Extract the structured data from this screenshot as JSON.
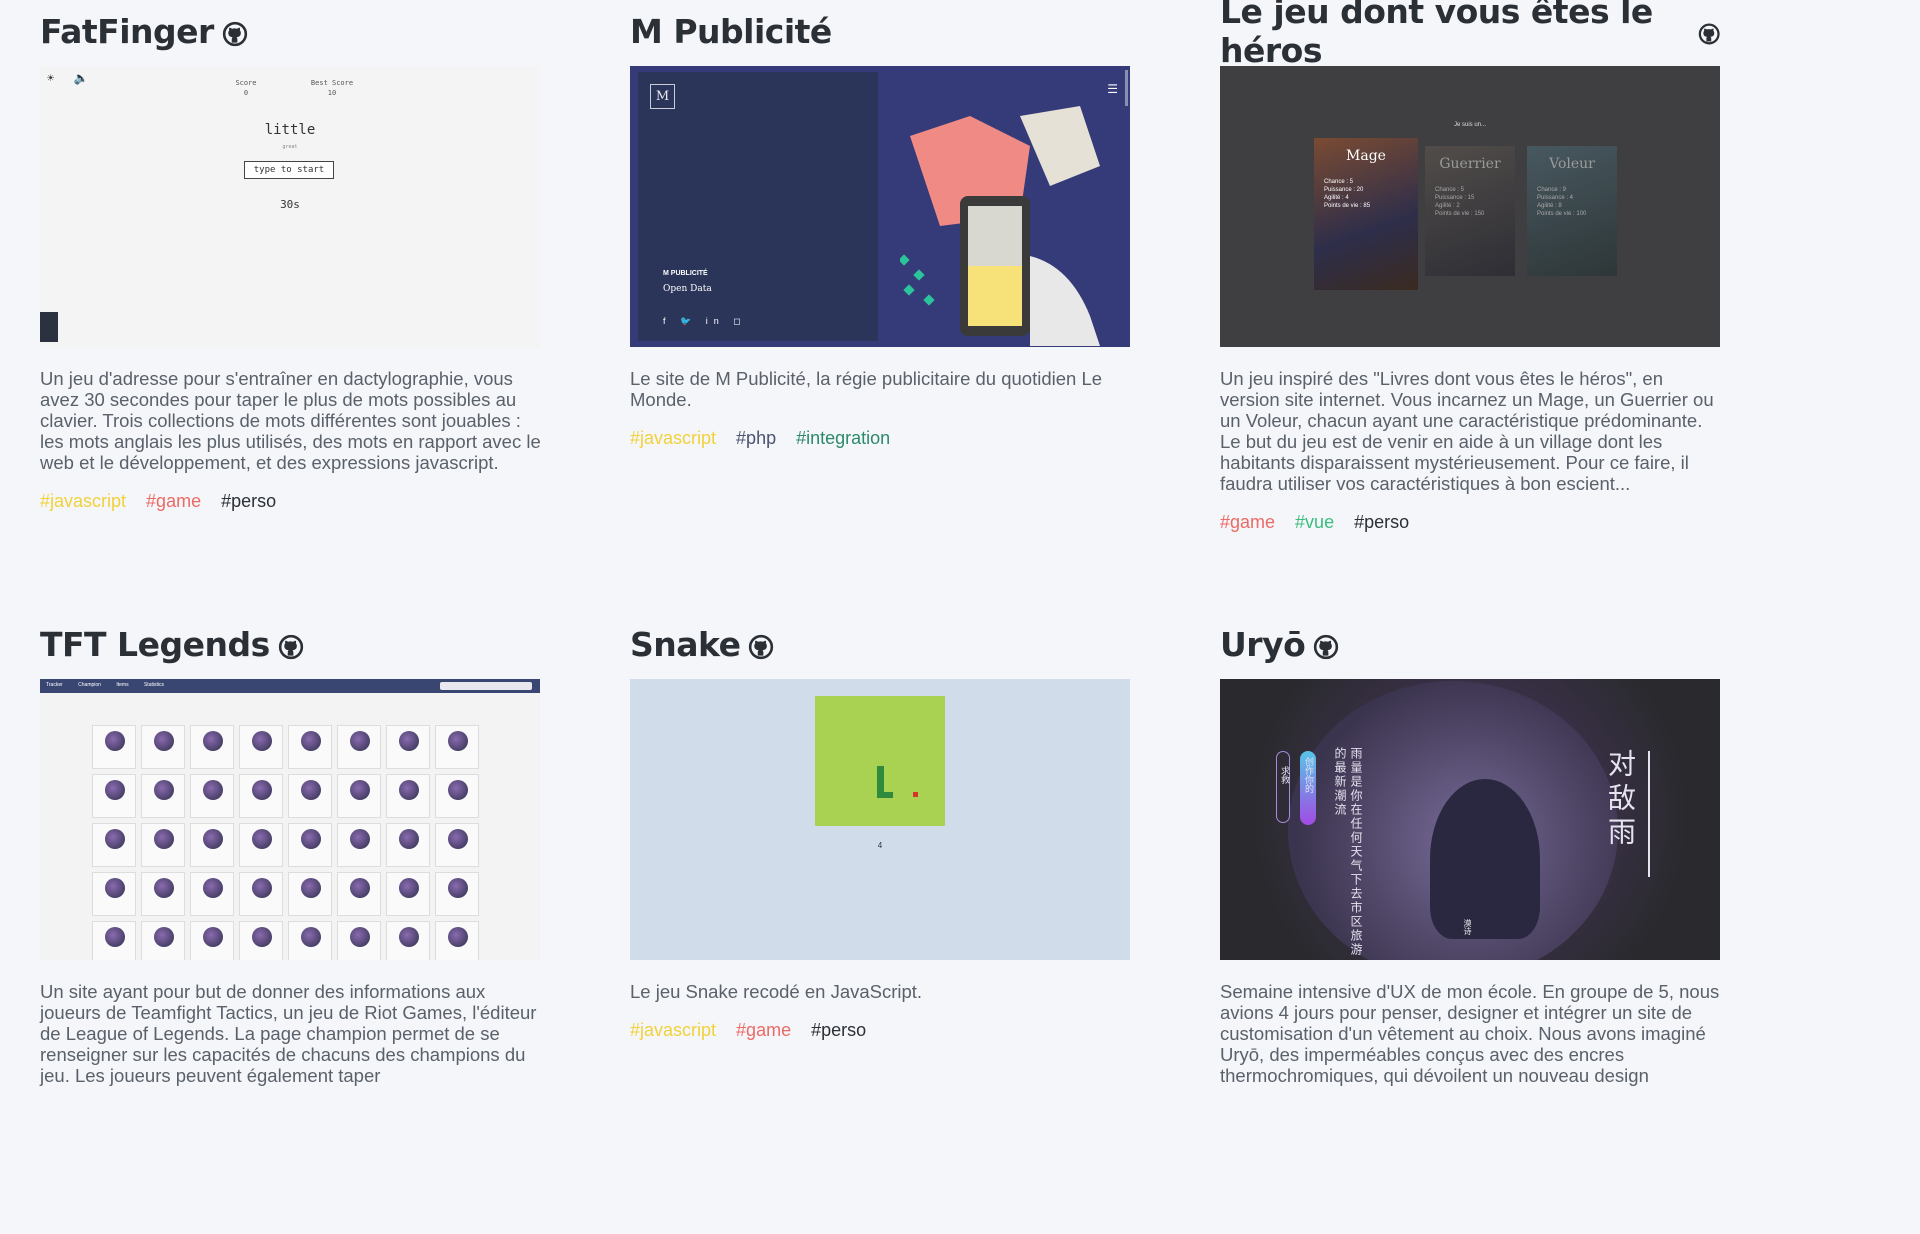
{
  "projects": [
    {
      "title": "FatFinger",
      "has_github": true,
      "description": "Un jeu d'adresse pour s'entraîner en dactylographie, vous avez 30 secondes pour taper le plus de mots possibles au clavier. Trois collections de mots différentes sont jouables : les mots anglais les plus utilisés, des mots en rapport avec le web et le développement, et des expressions javascript.",
      "tags": [
        "#javascript",
        "#game",
        "#perso"
      ],
      "thumb": {
        "score_label": "Score",
        "score_value": "0",
        "best_label": "Best Score",
        "best_value": "10",
        "word": "little",
        "word_sub": "great",
        "input_placeholder": "type to start",
        "timer": "30s"
      }
    },
    {
      "title": "M Publicité",
      "has_github": false,
      "description": "Le site de M Publicité, la régie publicitaire du quotidien Le Monde.",
      "tags": [
        "#javascript",
        "#php",
        "#integration"
      ],
      "thumb": {
        "logo": "M",
        "line1": "M PUBLICITÉ",
        "line2": "Open Data",
        "social": "f 🐦 in ◻"
      }
    },
    {
      "title": "Le jeu dont vous êtes le héros",
      "has_github": true,
      "description": "Un jeu inspiré des \"Livres dont vous êtes le héros\", en version site internet. Vous incarnez un Mage, un Guerrier ou un Voleur, chacun ayant une caractéristique prédominante. Le but du jeu est de venir en aide à un village dont les habitants disparaissent mystérieusement. Pour ce faire, il faudra utiliser vos caractéristiques à bon escient...",
      "tags": [
        "#game",
        "#vue",
        "#perso"
      ],
      "thumb": {
        "heading": "Je suis un...",
        "cards": [
          {
            "name": "Mage",
            "stats": "Chance : 5\nPuissance : 20\nAgilité : 4\nPoints de vie : 85"
          },
          {
            "name": "Guerrier",
            "stats": "Chance : 5\nPuissance : 15\nAgilité : 2\nPoints de vie : 150"
          },
          {
            "name": "Voleur",
            "stats": "Chance : 9\nPuissance : 4\nAgilité : 8\nPoints de vie : 100"
          }
        ]
      }
    },
    {
      "title": "TFT Legends",
      "has_github": true,
      "description": "Un site ayant pour but de donner des informations aux joueurs de Teamfight Tactics, un jeu de Riot Games, l'éditeur de League of Legends. La page champion permet de se renseigner sur les capacités de chacuns des champions du jeu. Les joueurs peuvent également taper",
      "tags": [],
      "thumb": {
        "nav": [
          "Tracker",
          "Champion",
          "Items",
          "Statistics"
        ]
      }
    },
    {
      "title": "Snake",
      "has_github": true,
      "description": "Le jeu Snake recodé en JavaScript.",
      "tags": [
        "#javascript",
        "#game",
        "#perso"
      ],
      "thumb": {
        "score": "4"
      }
    },
    {
      "title": "Uryō",
      "has_github": true,
      "description": "Semaine intensive d'UX de mon école. En groupe de 5, nous avions 4 jours pour penser, designer et intégrer un site de customisation d'un vêtement au choix. Nous avons imaginé Uryō, des imperméables conçus avec des encres thermochromiques, qui dévoilent un nouveau design",
      "tags": [],
      "thumb": {
        "big_text": "对敌雨",
        "poem": "雨量是你在任何天气下去市区旅游的最新潮流",
        "pill_left": "求救",
        "pill_right": "创作你的",
        "signature": "漠诗"
      }
    }
  ]
}
